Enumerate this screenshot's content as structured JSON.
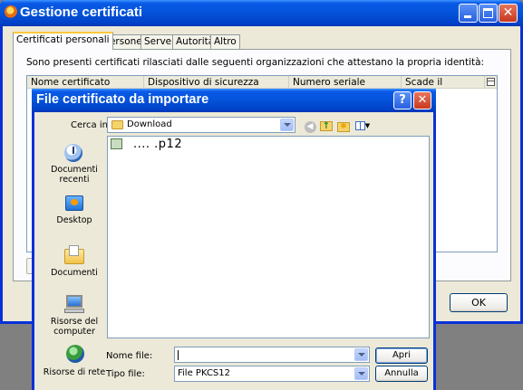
{
  "window": {
    "title": "Gestione certificati",
    "tabs": [
      "Certificati personali",
      "Persone",
      "Server",
      "Autorità",
      "Altro"
    ],
    "intro_text": "Sono presenti certificati rilasciati dalle seguenti organizzazioni che attestano la propria identità:",
    "columns": [
      "Nome certificato",
      "Dispositivo di sicurezza",
      "Numero seriale",
      "Scade il"
    ],
    "ok_label": "OK"
  },
  "dialog": {
    "title": "File certificato da importare",
    "help_label": "?",
    "look_in_label": "Cerca in:",
    "look_in_value": "Download",
    "places": [
      "Documenti recenti",
      "Desktop",
      "Documenti",
      "Risorse del computer",
      "Risorse di rete"
    ],
    "files": [
      {
        "name": "....      .p12"
      }
    ],
    "file_name_label": "Nome file:",
    "file_name_value": "",
    "file_type_label": "Tipo file:",
    "file_type_value": "File PKCS12",
    "open_label": "Apri",
    "cancel_label": "Annulla"
  }
}
